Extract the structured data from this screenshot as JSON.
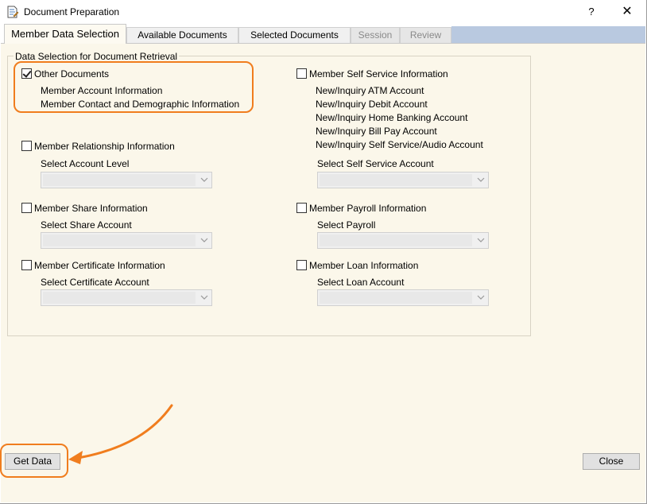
{
  "window": {
    "title": "Document Preparation",
    "help_label": "?",
    "close_glyph": "✕",
    "icon": "document-edit-icon"
  },
  "tabs": [
    {
      "label": "Member Data Selection",
      "active": true,
      "enabled": true
    },
    {
      "label": "Available Documents",
      "active": false,
      "enabled": true
    },
    {
      "label": "Selected Documents",
      "active": false,
      "enabled": true
    },
    {
      "label": "Session",
      "active": false,
      "enabled": false
    },
    {
      "label": "Review",
      "active": false,
      "enabled": false
    }
  ],
  "group": {
    "title": "Data Selection for Document Retrieval"
  },
  "left": {
    "other_documents": {
      "label": "Other Documents",
      "checked": true,
      "items": [
        "Member Account Information",
        "Member Contact and Demographic Information"
      ]
    },
    "relationship": {
      "label": "Member Relationship Information",
      "checked": false,
      "select_label": "Select Account Level",
      "value": ""
    },
    "share": {
      "label": "Member Share Information",
      "checked": false,
      "select_label": "Select Share Account",
      "value": ""
    },
    "certificate": {
      "label": "Member Certificate Information",
      "checked": false,
      "select_label": "Select Certificate Account",
      "value": ""
    }
  },
  "right": {
    "self_service": {
      "label": "Member Self Service Information",
      "checked": false,
      "items": [
        "New/Inquiry ATM Account",
        "New/Inquiry Debit Account",
        "New/Inquiry Home Banking Account",
        "New/Inquiry Bill Pay Account",
        "New/Inquiry Self Service/Audio Account"
      ],
      "select_label": "Select Self Service Account",
      "value": ""
    },
    "payroll": {
      "label": "Member Payroll Information",
      "checked": false,
      "select_label": "Select Payroll",
      "value": ""
    },
    "loan": {
      "label": "Member Loan Information",
      "checked": false,
      "select_label": "Select Loan Account",
      "value": ""
    }
  },
  "buttons": {
    "get_data": "Get Data",
    "close": "Close"
  },
  "colors": {
    "highlight": "#f07d1e",
    "panel_bg": "#fbf7ea",
    "tab_accent": "#b9c9e0"
  }
}
